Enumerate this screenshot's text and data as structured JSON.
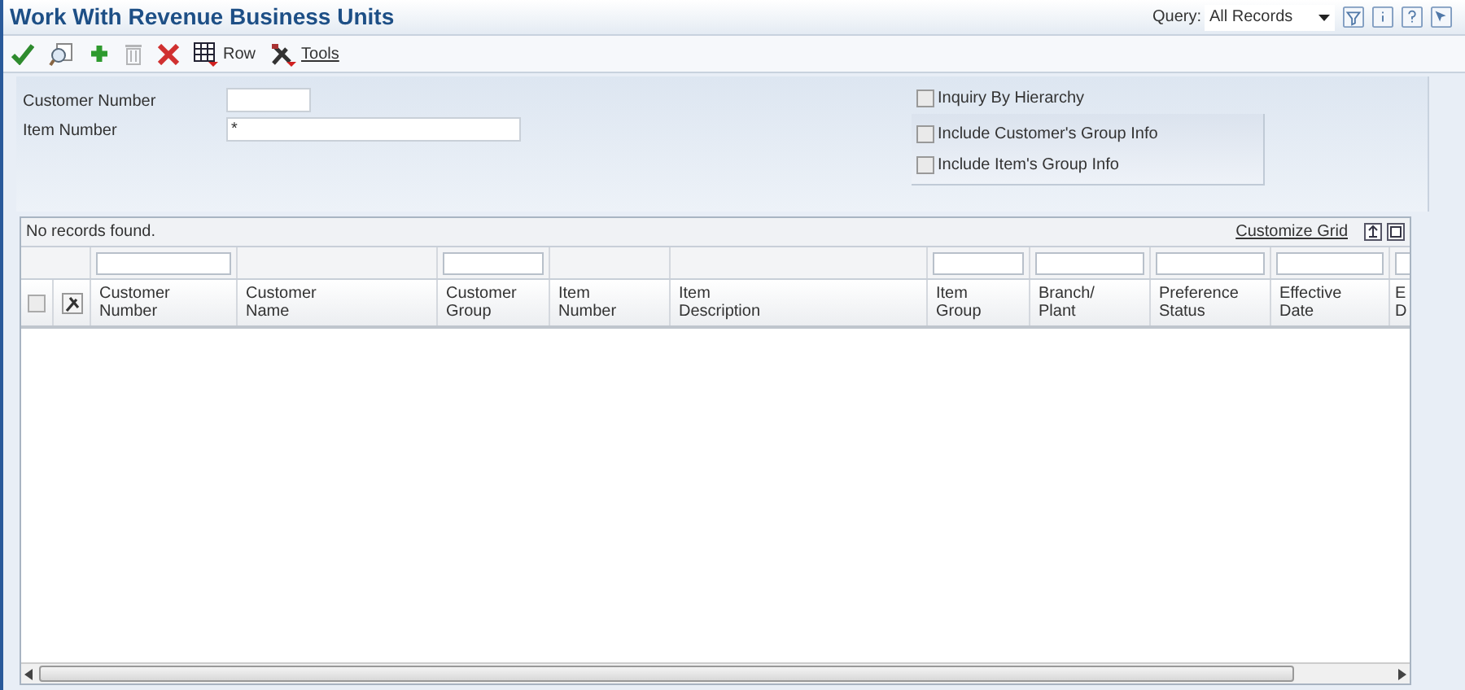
{
  "window": {
    "title": "Work With Revenue Business Units"
  },
  "query": {
    "label": "Query:",
    "value": "All Records"
  },
  "toolbar": [
    {
      "kind": "select"
    },
    {
      "kind": "find"
    },
    {
      "kind": "add"
    },
    {
      "kind": "delete",
      "disabled": true
    },
    {
      "kind": "close"
    },
    {
      "kind": "row",
      "label": "Row"
    },
    {
      "kind": "tools",
      "label": "Tools"
    }
  ],
  "fields": [
    {
      "label": "Customer Number"
    },
    {
      "label": "Item Number",
      "value": "*"
    }
  ],
  "options": [
    {
      "label": "Inquiry By Hierarchy",
      "checked": false,
      "grouped": false
    },
    {
      "label": "Include Customer's Group Info",
      "checked": false,
      "grouped": true
    },
    {
      "label": "Include Item's Group Info",
      "checked": false,
      "grouped": true
    }
  ],
  "grid": {
    "message": "No records found.",
    "select_all_checked": false,
    "customize": "Customize Grid",
    "columns": [
      {
        "label": [
          "Customer",
          "Number"
        ],
        "filter": true
      },
      {
        "label": [
          "Customer",
          "Name"
        ],
        "filter": false
      },
      {
        "label": [
          "Customer",
          "Group"
        ],
        "filter": true
      },
      {
        "label": [
          "Item",
          "Number"
        ],
        "filter": false
      },
      {
        "label": [
          "Item",
          "Description"
        ],
        "filter": false
      },
      {
        "label": [
          "Item",
          "Group"
        ],
        "filter": true
      },
      {
        "label": [
          "Branch/",
          "Plant"
        ],
        "filter": true
      },
      {
        "label": [
          "Preference",
          "Status"
        ],
        "filter": true
      },
      {
        "label": [
          "Effective",
          "Date"
        ],
        "filter": true
      },
      {
        "label": [
          "E",
          "D"
        ],
        "filter": true
      }
    ]
  }
}
